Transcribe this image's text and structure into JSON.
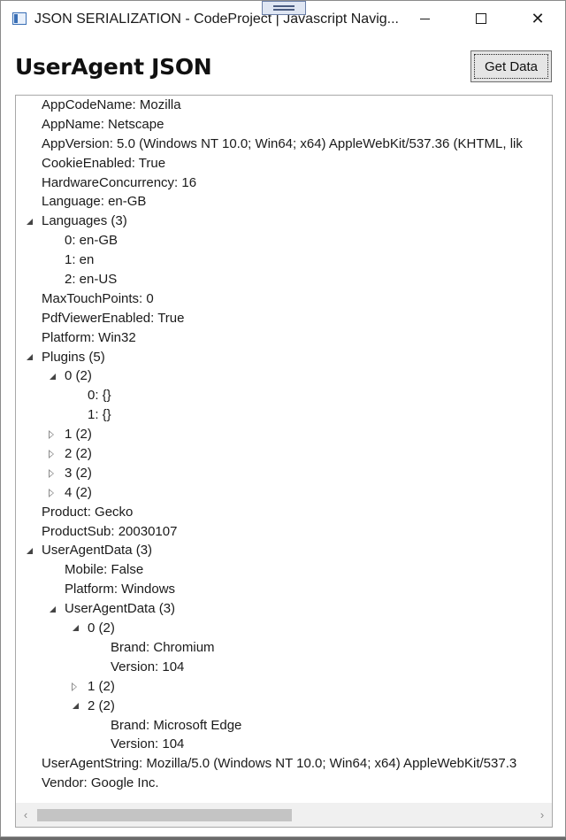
{
  "window": {
    "title": "JSON SERIALIZATION - CodeProject  |  Javascript Navig...",
    "minimize_label": "—",
    "close_label": "✕"
  },
  "header": {
    "title": "UserAgent JSON",
    "get_data_label": "Get Data"
  },
  "tree": [
    {
      "depth": 0,
      "toggle": "none",
      "text": "AppCodeName: Mozilla"
    },
    {
      "depth": 0,
      "toggle": "none",
      "text": "AppName: Netscape"
    },
    {
      "depth": 0,
      "toggle": "none",
      "text": "AppVersion: 5.0 (Windows NT 10.0; Win64; x64) AppleWebKit/537.36 (KHTML, lik"
    },
    {
      "depth": 0,
      "toggle": "none",
      "text": "CookieEnabled: True"
    },
    {
      "depth": 0,
      "toggle": "none",
      "text": "HardwareConcurrency: 16"
    },
    {
      "depth": 0,
      "toggle": "none",
      "text": "Language: en-GB"
    },
    {
      "depth": 0,
      "toggle": "expanded",
      "text": "Languages (3)"
    },
    {
      "depth": 1,
      "toggle": "none",
      "text": "0: en-GB"
    },
    {
      "depth": 1,
      "toggle": "none",
      "text": "1: en"
    },
    {
      "depth": 1,
      "toggle": "none",
      "text": "2: en-US"
    },
    {
      "depth": 0,
      "toggle": "none",
      "text": "MaxTouchPoints: 0"
    },
    {
      "depth": 0,
      "toggle": "none",
      "text": "PdfViewerEnabled: True"
    },
    {
      "depth": 0,
      "toggle": "none",
      "text": "Platform: Win32"
    },
    {
      "depth": 0,
      "toggle": "expanded",
      "text": "Plugins (5)"
    },
    {
      "depth": 1,
      "toggle": "expanded",
      "text": "0 (2)"
    },
    {
      "depth": 2,
      "toggle": "none",
      "text": "0: {}"
    },
    {
      "depth": 2,
      "toggle": "none",
      "text": "1: {}"
    },
    {
      "depth": 1,
      "toggle": "collapsed",
      "text": "1 (2)"
    },
    {
      "depth": 1,
      "toggle": "collapsed",
      "text": "2 (2)"
    },
    {
      "depth": 1,
      "toggle": "collapsed",
      "text": "3 (2)"
    },
    {
      "depth": 1,
      "toggle": "collapsed",
      "text": "4 (2)"
    },
    {
      "depth": 0,
      "toggle": "none",
      "text": "Product: Gecko"
    },
    {
      "depth": 0,
      "toggle": "none",
      "text": "ProductSub: 20030107"
    },
    {
      "depth": 0,
      "toggle": "expanded",
      "text": "UserAgentData (3)"
    },
    {
      "depth": 1,
      "toggle": "none",
      "text": "Mobile: False"
    },
    {
      "depth": 1,
      "toggle": "none",
      "text": "Platform: Windows"
    },
    {
      "depth": 1,
      "toggle": "expanded",
      "text": "UserAgentData (3)"
    },
    {
      "depth": 2,
      "toggle": "expanded",
      "text": "0 (2)"
    },
    {
      "depth": 3,
      "toggle": "none",
      "text": "Brand: Chromium"
    },
    {
      "depth": 3,
      "toggle": "none",
      "text": "Version: 104"
    },
    {
      "depth": 2,
      "toggle": "collapsed",
      "text": "1 (2)"
    },
    {
      "depth": 2,
      "toggle": "expanded",
      "text": "2 (2)"
    },
    {
      "depth": 3,
      "toggle": "none",
      "text": "Brand: Microsoft Edge"
    },
    {
      "depth": 3,
      "toggle": "none",
      "text": "Version: 104"
    },
    {
      "depth": 0,
      "toggle": "none",
      "text": "UserAgentString: Mozilla/5.0 (Windows NT 10.0; Win64; x64) AppleWebKit/537.3"
    },
    {
      "depth": 0,
      "toggle": "none",
      "text": "Vendor: Google Inc."
    }
  ],
  "scrollbar": {
    "left_arrow": "‹",
    "right_arrow": "›"
  }
}
